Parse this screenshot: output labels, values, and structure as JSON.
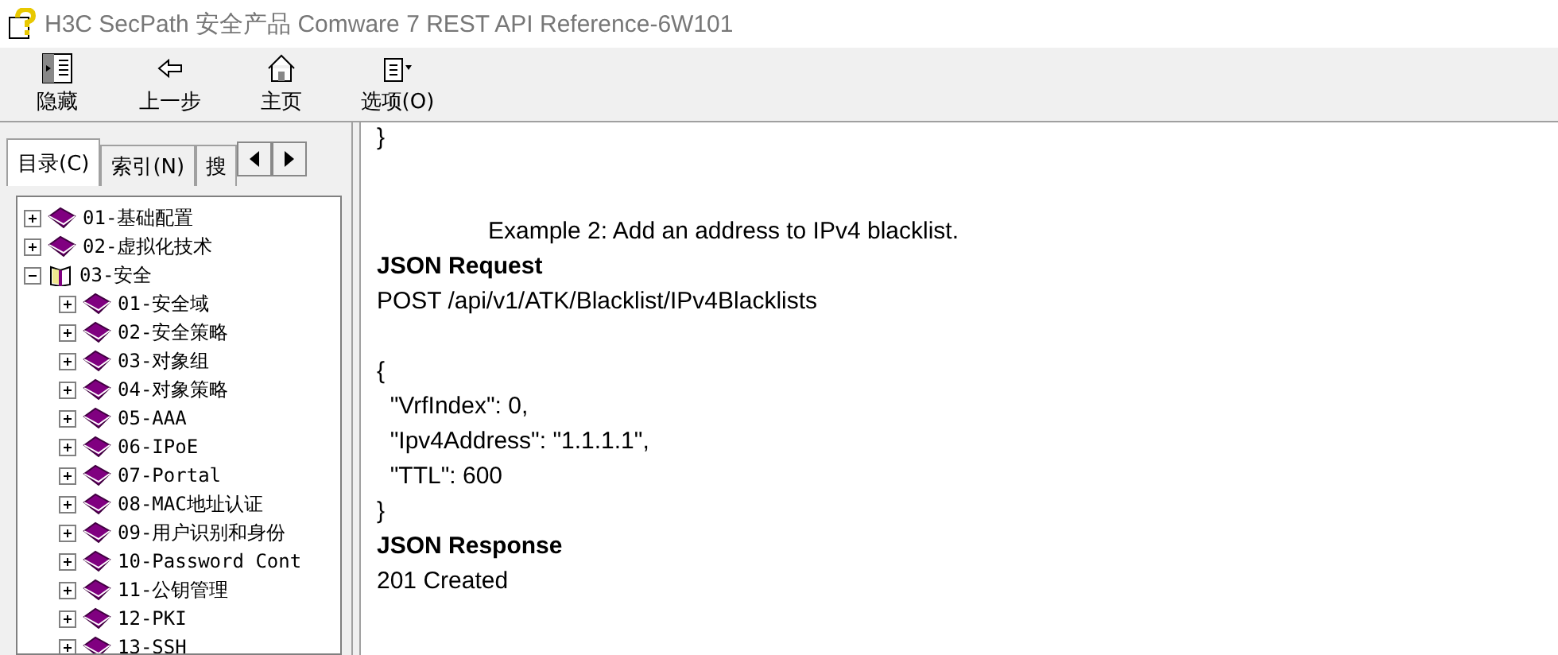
{
  "window": {
    "title": "H3C SecPath 安全产品 Comware 7 REST API Reference-6W101"
  },
  "toolbar": [
    {
      "label": "隐藏",
      "kind": "hide"
    },
    {
      "label": "上一步",
      "kind": "back"
    },
    {
      "label": "主页",
      "kind": "home"
    },
    {
      "label": "选项(O)",
      "kind": "options"
    }
  ],
  "tabs": [
    {
      "label": "目录(C)",
      "selected": true
    },
    {
      "label": "索引(N)",
      "selected": false
    },
    {
      "label": "搜",
      "selected": false
    }
  ],
  "tree": [
    {
      "label": "01-基础配置",
      "expanded": false
    },
    {
      "label": "02-虚拟化技术",
      "expanded": false
    },
    {
      "label": "03-安全",
      "expanded": true,
      "children": [
        {
          "label": "01-安全域",
          "expanded": false
        },
        {
          "label": "02-安全策略",
          "expanded": false
        },
        {
          "label": "03-对象组",
          "expanded": false
        },
        {
          "label": "04-对象策略",
          "expanded": false
        },
        {
          "label": "05-AAA",
          "expanded": false
        },
        {
          "label": "06-IPoE",
          "expanded": false
        },
        {
          "label": "07-Portal",
          "expanded": false
        },
        {
          "label": "08-MAC地址认证",
          "expanded": false
        },
        {
          "label": "09-用户识别和身份",
          "expanded": false
        },
        {
          "label": "10-Password Cont",
          "expanded": false
        },
        {
          "label": "11-公钥管理",
          "expanded": false
        },
        {
          "label": "12-PKI",
          "expanded": false
        },
        {
          "label": "13-SSH",
          "expanded": false
        }
      ]
    }
  ],
  "content": [
    {
      "kind": "code",
      "text": "}"
    },
    {
      "kind": "gap"
    },
    {
      "kind": "gap"
    },
    {
      "kind": "example",
      "text": "Example 2: Add an address to IPv4 blacklist."
    },
    {
      "kind": "heading",
      "text": "JSON Request"
    },
    {
      "kind": "code",
      "text": "POST /api/v1/ATK/Blacklist/IPv4Blacklists"
    },
    {
      "kind": "gap"
    },
    {
      "kind": "code",
      "text": "{"
    },
    {
      "kind": "code",
      "text": "  \"VrfIndex\": 0,"
    },
    {
      "kind": "code",
      "text": "  \"Ipv4Address\": \"1.1.1.1\","
    },
    {
      "kind": "code",
      "text": "  \"TTL\": 600"
    },
    {
      "kind": "code",
      "text": "}"
    },
    {
      "kind": "heading",
      "text": "JSON Response"
    },
    {
      "kind": "code",
      "text": "201 Created"
    }
  ]
}
